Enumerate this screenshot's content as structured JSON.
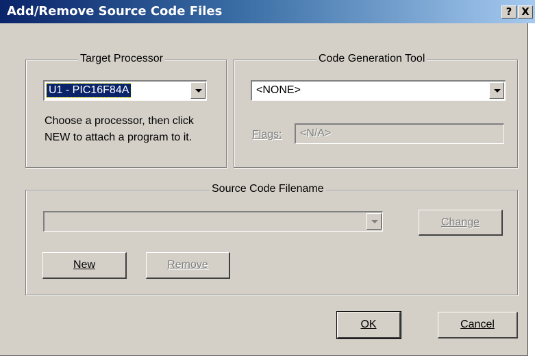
{
  "window": {
    "title": "Add/Remove Source Code Files",
    "help_label": "?",
    "close_label": "X"
  },
  "target_processor": {
    "label": "Target Processor",
    "selected": "U1 - PIC16F84A",
    "hint_line1": "Choose a processor, then click",
    "hint_line2": "NEW to attach a program to it."
  },
  "code_generation": {
    "label": "Code Generation Tool",
    "selected": "<NONE>",
    "flags_label": "Flags:",
    "flags_value": "<N/A>"
  },
  "source_code": {
    "label": "Source Code Filename",
    "filename": "",
    "change_label": "Change",
    "new_label": "New",
    "remove_label": "Remove"
  },
  "footer": {
    "ok_label": "OK",
    "cancel_label": "Cancel"
  }
}
